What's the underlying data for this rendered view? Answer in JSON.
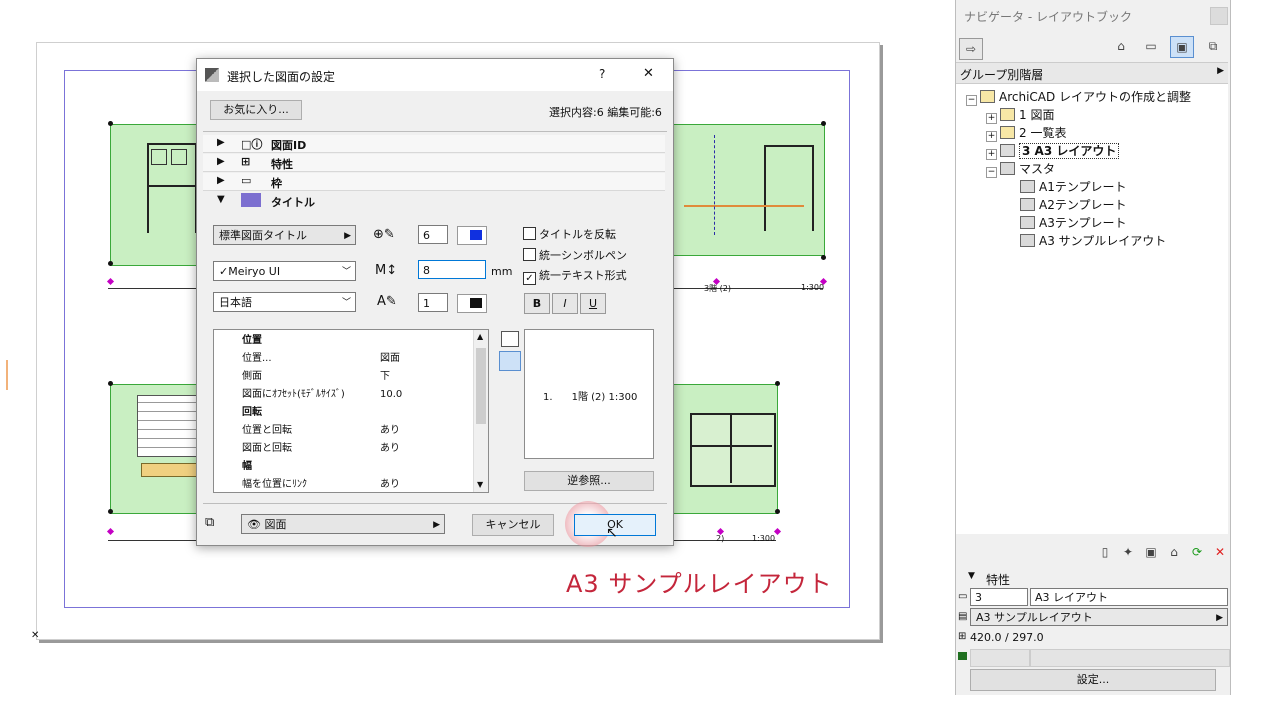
{
  "sheet": {
    "caption": "A3  サンプルレイアウト",
    "scale_labels": [
      "1:300",
      "3階 (2)",
      "1:300",
      "2)",
      "1:300"
    ]
  },
  "dialog": {
    "title": "選択した図面の設定",
    "help": "?",
    "close": "✕",
    "favorites_button": "お気に入り...",
    "selection_info": "選択内容:6 編集可能:6",
    "sections": [
      "図面ID",
      "特性",
      "枠",
      "タイトル"
    ],
    "title_type": "標準図面タイトル",
    "font": "Meiryo UI",
    "language": "日本語",
    "pen1_value": "6",
    "font_size_value": "8",
    "font_size_unit": "mm",
    "pen2_value": "1",
    "checkbox_flip": "タイトルを反転",
    "checkbox_uniform_pen": "統一シンボルペン",
    "checkbox_uniform_text": "統一テキスト形式",
    "format_bold": "B",
    "format_italic": "I",
    "format_underline": "U",
    "params": [
      {
        "k": "位置",
        "v": "",
        "hdr": true
      },
      {
        "k": "位置...",
        "v": "図面",
        "hdr": false
      },
      {
        "k": "側面",
        "v": "下",
        "hdr": false
      },
      {
        "k": "図面にｵﾌｾｯﾄ(ﾓﾃﾞﾙｻｲｽﾞ)",
        "v": "10.0",
        "hdr": false
      },
      {
        "k": "回転",
        "v": "",
        "hdr": true
      },
      {
        "k": "位置と回転",
        "v": "あり",
        "hdr": false
      },
      {
        "k": "図面と回転",
        "v": "あり",
        "hdr": false
      },
      {
        "k": "幅",
        "v": "",
        "hdr": true
      },
      {
        "k": "幅を位置にﾘﾝｸ",
        "v": "あり",
        "hdr": false
      }
    ],
    "preview_text": "1.      1階 (2) 1:300",
    "reverse_ref_button": "逆参照...",
    "layer_label": "図面",
    "cancel_button": "キャンセル",
    "ok_button": "OK"
  },
  "navigator": {
    "title": "ナビゲータ - レイアウトブック",
    "group_label": "グループ別階層",
    "tree": [
      {
        "label": "ArchiCAD レイアウトの作成と調整",
        "level": 0,
        "exp": "−",
        "kind": "book"
      },
      {
        "label": "1 図面",
        "level": 1,
        "exp": "+",
        "kind": "folder"
      },
      {
        "label": "2 一覧表",
        "level": 1,
        "exp": "+",
        "kind": "folder"
      },
      {
        "label": "3 A3  レイアウト",
        "level": 1,
        "exp": "+",
        "kind": "sheet",
        "selected": true
      },
      {
        "label": "マスタ",
        "level": 1,
        "exp": "−",
        "kind": "master"
      },
      {
        "label": "A1テンプレート",
        "level": 2,
        "exp": "",
        "kind": "master"
      },
      {
        "label": "A2テンプレート",
        "level": 2,
        "exp": "",
        "kind": "master"
      },
      {
        "label": "A3テンプレート",
        "level": 2,
        "exp": "",
        "kind": "master"
      },
      {
        "label": "A3  サンプルレイアウト",
        "level": 2,
        "exp": "",
        "kind": "master"
      }
    ],
    "props_header": "特性",
    "props_id": "3",
    "props_name": "A3  レイアウト",
    "props_master": "A3  サンプルレイアウト",
    "props_size": "420.0 / 297.0",
    "settings_button": "設定..."
  },
  "colors": {
    "accent_ok": "#0078d7",
    "caption_red": "#c4263b",
    "frame_purple": "#7b73d8",
    "plan_green": "#c9efc2",
    "delete_red": "#e02020",
    "pen_blue": "#1030e0"
  }
}
